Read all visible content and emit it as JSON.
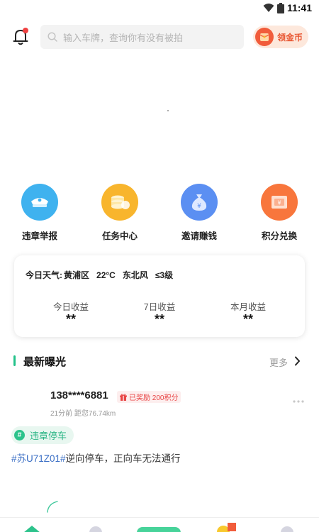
{
  "status_bar": {
    "time": "11:41"
  },
  "header": {
    "search_placeholder": "输入车牌，查询你有没有被拍",
    "coin_button_label": "领金币"
  },
  "actions": [
    {
      "label": "违章举报",
      "icon": "police-cap-icon",
      "color": "#3fb2ef"
    },
    {
      "label": "任务中心",
      "icon": "coins-stack-icon",
      "color": "#f8b52d"
    },
    {
      "label": "邀请赚钱",
      "icon": "money-bag-icon",
      "color": "#5b8ff2"
    },
    {
      "label": "积分兑换",
      "icon": "coupon-icon",
      "color": "#f8763c"
    }
  ],
  "weather": {
    "prefix": "今日天气:",
    "district": "黄浦区",
    "temperature": "22°C",
    "wind": "东北风",
    "level": "≤3级"
  },
  "earnings": [
    {
      "label": "今日收益",
      "value": "**"
    },
    {
      "label": "7日收益",
      "value": "**"
    },
    {
      "label": "本月收益",
      "value": "**"
    }
  ],
  "latest": {
    "title": "最新曝光",
    "more": "更多",
    "post": {
      "user": "138****6881",
      "badge": "已奖励 200积分",
      "meta": "21分前 距您76.74km",
      "tag": "违章停车",
      "hashtag": "#苏U71Z01#",
      "text": "逆向停车，正向车无法通行"
    }
  },
  "colors": {
    "accent_green": "#23c28a",
    "badge_red": "#e84444",
    "coin_orange": "#f15c3b"
  }
}
